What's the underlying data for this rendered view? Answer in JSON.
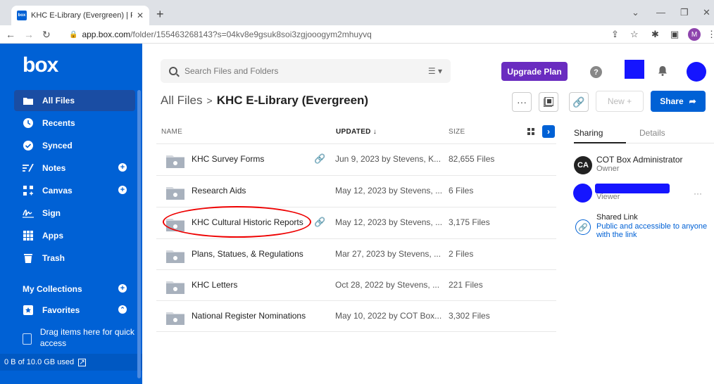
{
  "browser": {
    "tab_title": "KHC E-Library (Evergreen) | Power",
    "favicon_text": "box",
    "url_host": "app.box.com",
    "url_path": "/folder/155463268143?s=04kv8e9gsuk8soi3zgjooogym2mhuyvq",
    "profile_initial": "M"
  },
  "sidebar": {
    "logo": "box",
    "items": [
      {
        "label": "All Files",
        "icon": "folder-icon"
      },
      {
        "label": "Recents",
        "icon": "clock-icon"
      },
      {
        "label": "Synced",
        "icon": "check-circle-icon"
      },
      {
        "label": "Notes",
        "icon": "notes-icon"
      },
      {
        "label": "Canvas",
        "icon": "canvas-icon"
      },
      {
        "label": "Sign",
        "icon": "sign-icon"
      },
      {
        "label": "Apps",
        "icon": "apps-grid-icon"
      },
      {
        "label": "Trash",
        "icon": "trash-icon"
      },
      {
        "label": "My Collections",
        "icon": ""
      },
      {
        "label": "Favorites",
        "icon": "favorites-icon"
      }
    ],
    "drag_text": "Drag items here for quick access",
    "storage": "0 B of 10.0 GB used"
  },
  "header": {
    "search_placeholder": "Search Files and Folders",
    "upgrade_label": "Upgrade Plan",
    "help_label": "?"
  },
  "breadcrumb": {
    "root": "All Files",
    "separator": ">",
    "current": "KHC E-Library (Evergreen)"
  },
  "toolbar": {
    "more_label": "···",
    "new_label": "New +",
    "share_label": "Share"
  },
  "table": {
    "columns": {
      "name": "NAME",
      "updated": "UPDATED ↓",
      "size": "SIZE"
    },
    "rows": [
      {
        "name": "KHC Survey Forms",
        "shared": true,
        "updated": "Jun 9, 2023 by Stevens, K...",
        "size": "82,655 Files"
      },
      {
        "name": "Research Aids",
        "shared": false,
        "updated": "May 12, 2023 by Stevens, ...",
        "size": "6 Files"
      },
      {
        "name": "KHC Cultural Historic Reports",
        "shared": true,
        "updated": "May 12, 2023 by Stevens, ...",
        "size": "3,175 Files"
      },
      {
        "name": "Plans, Statues, & Regulations",
        "shared": false,
        "updated": "Mar 27, 2023 by Stevens, ...",
        "size": "2 Files"
      },
      {
        "name": "KHC Letters",
        "shared": false,
        "updated": "Oct 28, 2022 by Stevens, ...",
        "size": "221 Files"
      },
      {
        "name": "National Register Nominations",
        "shared": false,
        "updated": "May 10, 2022 by COT Box...",
        "size": "3,302 Files"
      }
    ]
  },
  "panel": {
    "tabs": [
      "Sharing",
      "Details"
    ],
    "owner": {
      "initials": "CA",
      "name": "COT Box Administrator",
      "role": "Owner"
    },
    "collaborator": {
      "role": "Viewer"
    },
    "shared_link": {
      "title": "Shared Link",
      "desc": "Public and accessible to anyone with the link"
    }
  },
  "colors": {
    "brand": "#0061d5",
    "upgrade": "#6a2cc0",
    "annotation": "#e00000",
    "redaction": "#1515ff"
  }
}
